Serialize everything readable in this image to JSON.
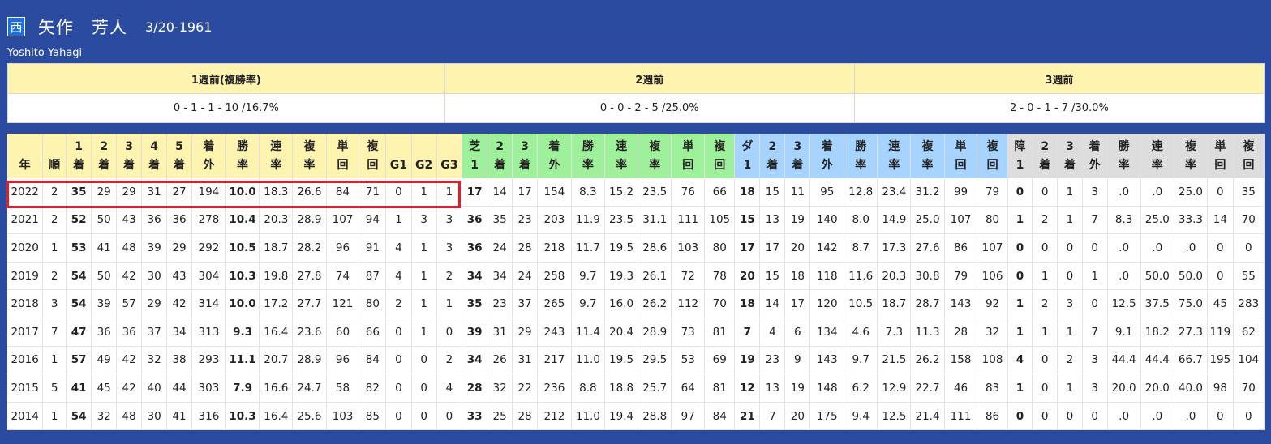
{
  "header": {
    "badge": "西",
    "name": "矢作　芳人",
    "birth": "3/20-1961",
    "english_name": "Yoshito Yahagi"
  },
  "weeks": {
    "headers": [
      "1週前(複勝率)",
      "2週前",
      "3週前"
    ],
    "values": [
      "0 - 1 - 1 - 10 /16.7%",
      "0 - 0 - 2 - 5 /25.0%",
      "2 - 0 - 1 - 7 /30.0%"
    ]
  },
  "stats": {
    "columns": [
      {
        "l1": "",
        "l2": "年",
        "g": 0
      },
      {
        "l1": "",
        "l2": "順",
        "g": 0
      },
      {
        "l1": "1",
        "l2": "着",
        "g": 0
      },
      {
        "l1": "2",
        "l2": "着",
        "g": 0
      },
      {
        "l1": "3",
        "l2": "着",
        "g": 0
      },
      {
        "l1": "4",
        "l2": "着",
        "g": 0
      },
      {
        "l1": "5",
        "l2": "着",
        "g": 0
      },
      {
        "l1": "着",
        "l2": "外",
        "g": 0
      },
      {
        "l1": "勝",
        "l2": "率",
        "g": 0
      },
      {
        "l1": "連",
        "l2": "率",
        "g": 0
      },
      {
        "l1": "複",
        "l2": "率",
        "g": 0
      },
      {
        "l1": "単",
        "l2": "回",
        "g": 0
      },
      {
        "l1": "複",
        "l2": "回",
        "g": 0
      },
      {
        "l1": "",
        "l2": "G1",
        "g": 0
      },
      {
        "l1": "",
        "l2": "G2",
        "g": 0
      },
      {
        "l1": "",
        "l2": "G3",
        "g": 0
      },
      {
        "l1": "芝",
        "l2": "1",
        "g": 1
      },
      {
        "l1": "2",
        "l2": "着",
        "g": 1
      },
      {
        "l1": "3",
        "l2": "着",
        "g": 1
      },
      {
        "l1": "着",
        "l2": "外",
        "g": 1
      },
      {
        "l1": "勝",
        "l2": "率",
        "g": 1
      },
      {
        "l1": "連",
        "l2": "率",
        "g": 1
      },
      {
        "l1": "複",
        "l2": "率",
        "g": 1
      },
      {
        "l1": "単",
        "l2": "回",
        "g": 1
      },
      {
        "l1": "複",
        "l2": "回",
        "g": 1
      },
      {
        "l1": "ダ",
        "l2": "1",
        "g": 2
      },
      {
        "l1": "2",
        "l2": "着",
        "g": 2
      },
      {
        "l1": "3",
        "l2": "着",
        "g": 2
      },
      {
        "l1": "着",
        "l2": "外",
        "g": 2
      },
      {
        "l1": "勝",
        "l2": "率",
        "g": 2
      },
      {
        "l1": "連",
        "l2": "率",
        "g": 2
      },
      {
        "l1": "複",
        "l2": "率",
        "g": 2
      },
      {
        "l1": "単",
        "l2": "回",
        "g": 2
      },
      {
        "l1": "複",
        "l2": "回",
        "g": 2
      },
      {
        "l1": "障",
        "l2": "1",
        "g": 3
      },
      {
        "l1": "2",
        "l2": "着",
        "g": 3
      },
      {
        "l1": "3",
        "l2": "着",
        "g": 3
      },
      {
        "l1": "着",
        "l2": "外",
        "g": 3
      },
      {
        "l1": "勝",
        "l2": "率",
        "g": 3
      },
      {
        "l1": "連",
        "l2": "率",
        "g": 3
      },
      {
        "l1": "複",
        "l2": "率",
        "g": 3
      },
      {
        "l1": "単",
        "l2": "回",
        "g": 3
      },
      {
        "l1": "複",
        "l2": "回",
        "g": 3
      }
    ],
    "rows": [
      [
        "2022",
        "2",
        "35",
        "29",
        "29",
        "31",
        "27",
        "194",
        "10.0",
        "18.3",
        "26.6",
        "84",
        "71",
        "0",
        "1",
        "1",
        "17",
        "14",
        "17",
        "154",
        "8.3",
        "15.2",
        "23.5",
        "76",
        "66",
        "18",
        "15",
        "11",
        "95",
        "12.8",
        "23.4",
        "31.2",
        "99",
        "79",
        "0",
        "0",
        "1",
        "3",
        ".0",
        ".0",
        "25.0",
        "0",
        "35"
      ],
      [
        "2021",
        "2",
        "52",
        "50",
        "43",
        "36",
        "36",
        "278",
        "10.4",
        "20.3",
        "28.9",
        "107",
        "94",
        "1",
        "3",
        "3",
        "36",
        "35",
        "23",
        "203",
        "11.9",
        "23.5",
        "31.1",
        "111",
        "105",
        "15",
        "13",
        "19",
        "140",
        "8.0",
        "14.9",
        "25.0",
        "107",
        "80",
        "1",
        "2",
        "1",
        "7",
        "8.3",
        "25.0",
        "33.3",
        "14",
        "70"
      ],
      [
        "2020",
        "1",
        "53",
        "41",
        "48",
        "39",
        "29",
        "292",
        "10.5",
        "18.7",
        "28.2",
        "96",
        "91",
        "4",
        "1",
        "3",
        "36",
        "24",
        "28",
        "218",
        "11.7",
        "19.5",
        "28.6",
        "103",
        "80",
        "17",
        "17",
        "20",
        "142",
        "8.7",
        "17.3",
        "27.6",
        "86",
        "107",
        "0",
        "0",
        "0",
        "0",
        ".0",
        ".0",
        ".0",
        "0",
        "0"
      ],
      [
        "2019",
        "2",
        "54",
        "50",
        "42",
        "30",
        "43",
        "304",
        "10.3",
        "19.8",
        "27.8",
        "74",
        "87",
        "4",
        "1",
        "2",
        "34",
        "34",
        "24",
        "258",
        "9.7",
        "19.3",
        "26.1",
        "72",
        "78",
        "20",
        "15",
        "18",
        "118",
        "11.6",
        "20.3",
        "30.8",
        "79",
        "106",
        "0",
        "1",
        "0",
        "1",
        ".0",
        "50.0",
        "50.0",
        "0",
        "55"
      ],
      [
        "2018",
        "3",
        "54",
        "39",
        "57",
        "29",
        "42",
        "314",
        "10.0",
        "17.2",
        "27.7",
        "121",
        "80",
        "2",
        "1",
        "1",
        "35",
        "23",
        "37",
        "265",
        "9.7",
        "16.0",
        "26.2",
        "112",
        "70",
        "18",
        "14",
        "17",
        "120",
        "10.5",
        "18.7",
        "28.7",
        "143",
        "92",
        "1",
        "2",
        "3",
        "0",
        "12.5",
        "37.5",
        "75.0",
        "45",
        "283"
      ],
      [
        "2017",
        "7",
        "47",
        "36",
        "36",
        "37",
        "34",
        "313",
        "9.3",
        "16.4",
        "23.6",
        "60",
        "66",
        "0",
        "1",
        "0",
        "39",
        "31",
        "29",
        "243",
        "11.4",
        "20.4",
        "28.9",
        "73",
        "81",
        "7",
        "4",
        "6",
        "134",
        "4.6",
        "7.3",
        "11.3",
        "28",
        "32",
        "1",
        "1",
        "1",
        "7",
        "9.1",
        "18.2",
        "27.3",
        "119",
        "62"
      ],
      [
        "2016",
        "1",
        "57",
        "49",
        "42",
        "32",
        "38",
        "293",
        "11.1",
        "20.7",
        "28.9",
        "96",
        "84",
        "0",
        "0",
        "2",
        "34",
        "26",
        "31",
        "217",
        "11.0",
        "19.5",
        "29.5",
        "53",
        "69",
        "19",
        "23",
        "9",
        "143",
        "9.7",
        "21.5",
        "26.2",
        "158",
        "108",
        "4",
        "0",
        "2",
        "3",
        "44.4",
        "44.4",
        "66.7",
        "195",
        "104"
      ],
      [
        "2015",
        "5",
        "41",
        "45",
        "42",
        "40",
        "44",
        "303",
        "7.9",
        "16.6",
        "24.7",
        "58",
        "82",
        "0",
        "0",
        "4",
        "28",
        "32",
        "22",
        "236",
        "8.8",
        "18.8",
        "25.7",
        "64",
        "81",
        "12",
        "13",
        "19",
        "148",
        "6.2",
        "12.9",
        "22.7",
        "46",
        "83",
        "1",
        "0",
        "1",
        "3",
        "20.0",
        "20.0",
        "40.0",
        "98",
        "70"
      ],
      [
        "2014",
        "1",
        "54",
        "32",
        "48",
        "30",
        "41",
        "316",
        "10.3",
        "16.4",
        "25.6",
        "103",
        "85",
        "0",
        "0",
        "0",
        "33",
        "25",
        "28",
        "212",
        "11.0",
        "19.4",
        "28.8",
        "97",
        "84",
        "21",
        "7",
        "20",
        "175",
        "9.4",
        "12.5",
        "21.4",
        "111",
        "86",
        "0",
        "0",
        "0",
        "0",
        ".0",
        ".0",
        ".0",
        "0",
        "0"
      ]
    ]
  },
  "colors": {
    "background": "#2b4ba0",
    "highlight": "#e11d2a",
    "header_yellow": "#fff3b0",
    "turf_green": "#9ef09a",
    "dirt_blue": "#a6d3ff",
    "jump_gray": "#dddddd"
  }
}
